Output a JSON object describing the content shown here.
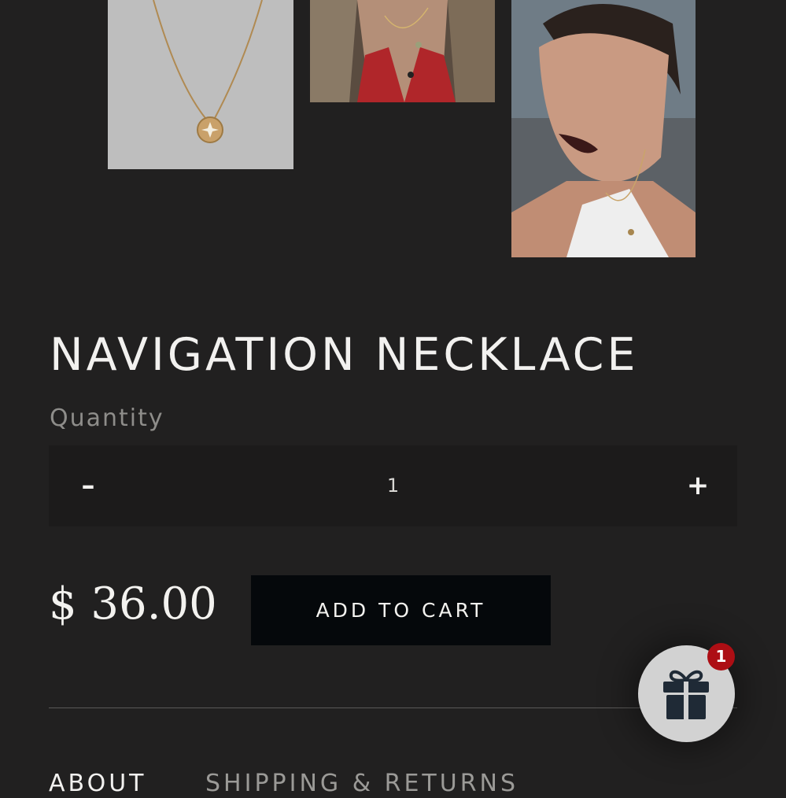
{
  "product": {
    "title": "NAVIGATION NECKLACE",
    "price": "$ 36.00"
  },
  "quantity": {
    "label": "Quantity",
    "value": "1",
    "minus_label": "–",
    "plus_label": "+"
  },
  "cart": {
    "add_label": "ADD TO CART"
  },
  "tabs": [
    {
      "label": "ABOUT"
    },
    {
      "label": "SHIPPING & RETURNS"
    }
  ],
  "gift_widget": {
    "icon": "gift-icon",
    "badge_count": "1"
  },
  "colors": {
    "background": "#212020",
    "button_background": "#05080b",
    "badge": "#ad0e14"
  }
}
